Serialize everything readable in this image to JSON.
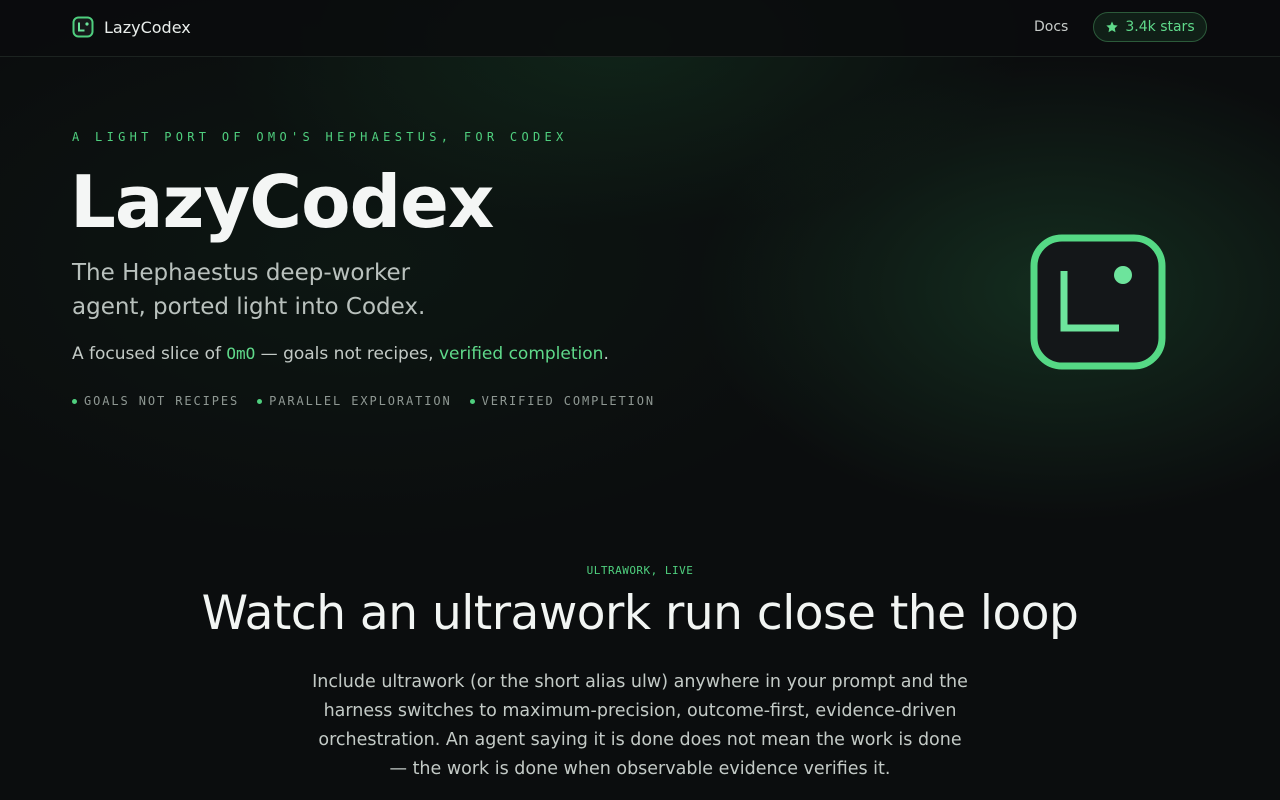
{
  "header": {
    "brand_name": "LazyCodex",
    "docs_label": "Docs",
    "stars_label": "3.4k stars"
  },
  "hero": {
    "eyebrow": "A LIGHT PORT OF OMO'S HEPHAESTUS, FOR CODEX",
    "title": "LazyCodex",
    "subtitle": "The Hephaestus deep-worker agent, ported light into Codex.",
    "desc_prefix": "A focused slice of ",
    "desc_code": "OmO",
    "desc_middle": " — goals not recipes, ",
    "desc_highlight": "verified completion",
    "desc_suffix": ".",
    "features": [
      "GOALS NOT RECIPES",
      "PARALLEL EXPLORATION",
      "VERIFIED COMPLETION"
    ]
  },
  "ultrawork": {
    "eyebrow": "ULTRAWORK, LIVE",
    "title": "Watch an ultrawork run close the loop",
    "body": "Include ultrawork (or the short alias ulw) anywhere in your prompt and the harness switches to maximum-precision, outcome-first, evidence-driven orchestration. An agent saying it is done does not mean the work is done — the work is done when observable evidence verifies it."
  },
  "icons": {
    "brand": "lazycodex-logo-icon",
    "star": "star-icon",
    "hero_logo": "lazycodex-logo-icon"
  },
  "colors": {
    "background": "#0b0d0e",
    "accent": "#4fcf7e",
    "accent_light": "#5fd98a",
    "text": "#f4f6f5",
    "muted": "#8f9893"
  }
}
